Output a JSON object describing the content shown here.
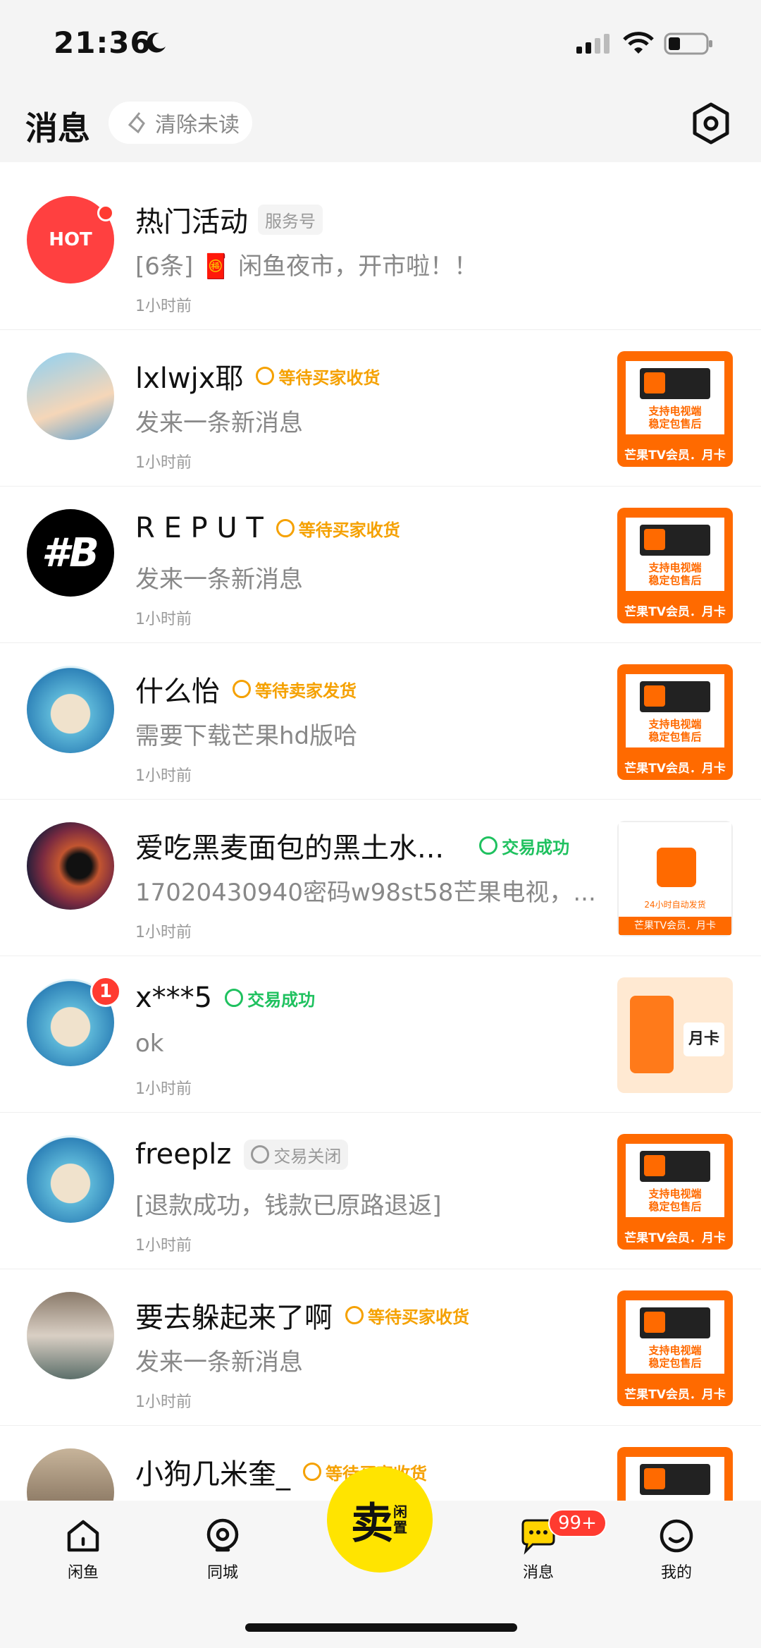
{
  "status_bar": {
    "time": "21:36"
  },
  "header": {
    "title": "消息",
    "clear_label": "清除未读"
  },
  "conversations": [
    {
      "name": "热门活动",
      "tag": "服务号",
      "message": "[6条] 🧧 闲鱼夜市，开市啦！！",
      "time": "1小时前"
    },
    {
      "name": "lxlwjx耶",
      "status": "等待买家收货",
      "message": "发来一条新消息",
      "time": "1小时前"
    },
    {
      "name": "R E P U T",
      "status": "等待买家收货",
      "message": "发来一条新消息",
      "time": "1小时前"
    },
    {
      "name": "什么怡",
      "status": "等待卖家发货",
      "message": "需要下载芒果hd版哈",
      "time": "1小时前"
    },
    {
      "name": "爱吃黑麦面包的黑土水...",
      "status": "交易成功",
      "message": "17020430940密码w98st58芒果电视，...",
      "time": "1小时前"
    },
    {
      "name": "x***5",
      "status": "交易成功",
      "message": "ok",
      "time": "1小时前",
      "unread": "1"
    },
    {
      "name": "freeplz",
      "status": "交易关闭",
      "message": "[退款成功，钱款已原路退返]",
      "time": "1小时前"
    },
    {
      "name": "要去躲起来了啊",
      "status": "等待买家收货",
      "message": "发来一条新消息",
      "time": "1小时前"
    },
    {
      "name": "小狗几米奎_",
      "status": "等待买家收货"
    }
  ],
  "thumbs": {
    "mango_tv_label": "芒果TV会员．月卡",
    "mango_tv_line1": "支持电视端",
    "mango_tv_line2": "稳定包售后",
    "alt_footer": "芒果TV会员．月卡",
    "alt_line": "24小时自动发货",
    "card_label": "月卡"
  },
  "hot_badge": "HOT",
  "tabbar": {
    "home": "闲鱼",
    "nearby": "同城",
    "sell_main": "卖",
    "sell_sub": "闲置",
    "messages": "消息",
    "messages_count": "99+",
    "me": "我的"
  },
  "colors": {
    "accent": "#ffe400",
    "wait": "#f5a100",
    "ok": "#1fc15f",
    "badge": "#ff3b30",
    "mango": "#ff6a00"
  }
}
